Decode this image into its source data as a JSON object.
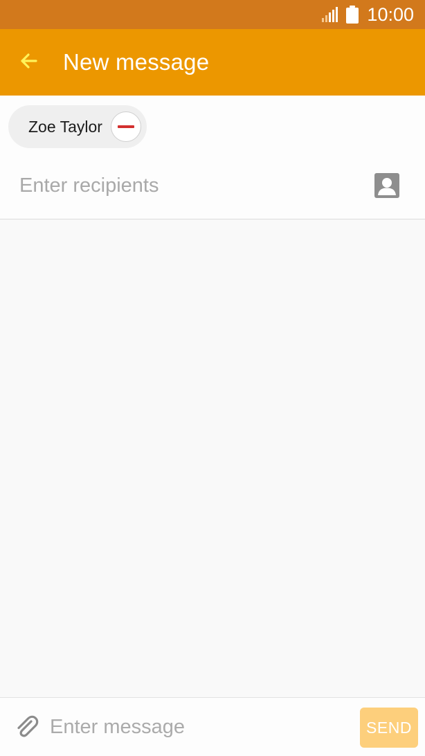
{
  "status_bar": {
    "time": "10:00",
    "icons": [
      "signal-icon",
      "battery-icon"
    ]
  },
  "app_bar": {
    "title": "New message",
    "back_icon": "arrow-left-icon"
  },
  "recipients": {
    "chips": [
      {
        "name": "Zoe Taylor",
        "remove_icon": "minus-circle-icon"
      }
    ],
    "placeholder": "Enter recipients",
    "contacts_icon": "contact-card-icon"
  },
  "composer": {
    "attach_icon": "paperclip-icon",
    "placeholder": "Enter message",
    "send_label": "SEND"
  },
  "colors": {
    "status_bar": "#d2791c",
    "app_bar": "#ec9700",
    "back_arrow": "#fff35a",
    "remove_accent": "#d3302f",
    "send_disabled": "#fdcf7c"
  }
}
